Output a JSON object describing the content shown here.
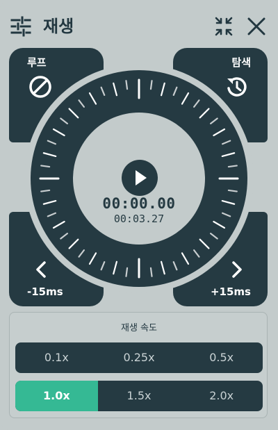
{
  "header": {
    "title": "재생",
    "settings_icon": "sliders-icon",
    "collapse_icon": "collapse-icon",
    "close_icon": "close-icon"
  },
  "corners": {
    "loop_label": "루프",
    "loop_icon": "loop-off-icon",
    "seek_label": "탐색",
    "seek_icon": "history-icon",
    "back_label": "-15ms",
    "back_icon": "chevron-left-icon",
    "forward_label": "+15ms",
    "forward_icon": "chevron-right-icon"
  },
  "dial": {
    "current_time": "00:00.00",
    "total_time": "00:03.27",
    "play_icon": "play-icon"
  },
  "speed": {
    "title": "재생 속도",
    "options": [
      "0.1x",
      "0.25x",
      "0.5x",
      "1.0x",
      "1.5x",
      "2.0x"
    ],
    "selected": "1.0x"
  },
  "colors": {
    "background": "#c3cbcb",
    "dark": "#253a42",
    "accent": "#35b994"
  }
}
